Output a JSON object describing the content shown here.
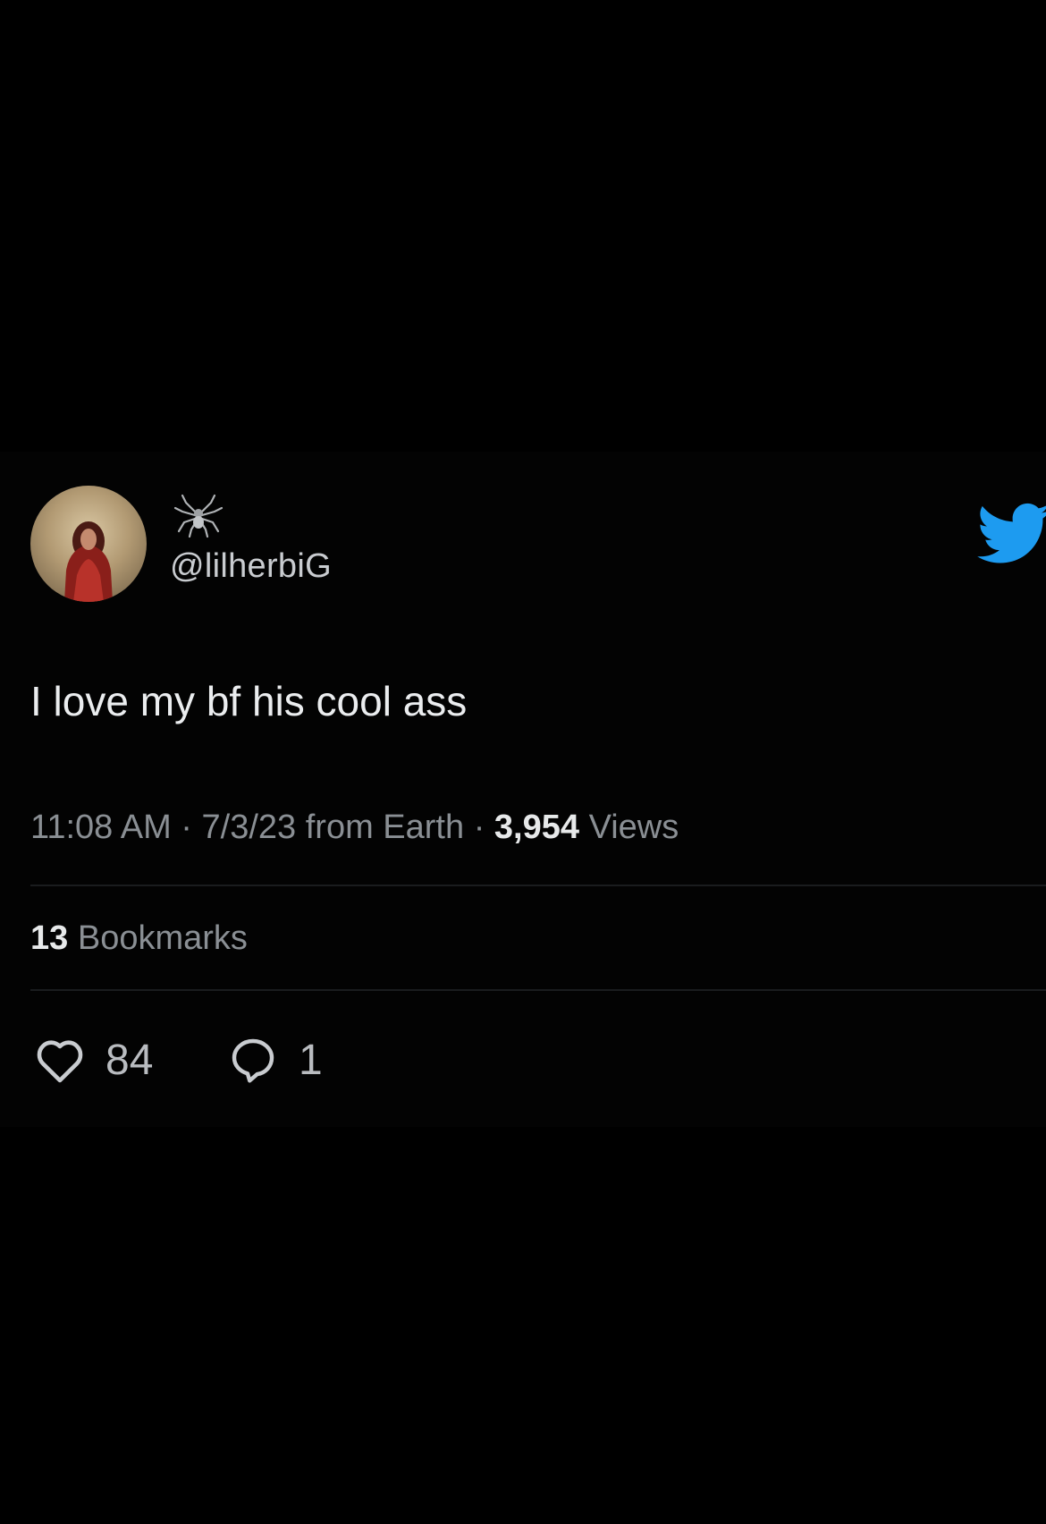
{
  "user": {
    "name_emoji": "spider-emoji",
    "handle": "@lilherbiG",
    "avatar_icon": "profile-photo"
  },
  "brand": {
    "logo_icon": "twitter-bird-icon",
    "logo_color": "#1d9bf0"
  },
  "tweet": {
    "text": "I love my bf his cool ass",
    "time": "11:08 AM",
    "date": "7/3/23",
    "source": "from Earth",
    "views_count": "3,954",
    "views_label": "Views",
    "separator": "·"
  },
  "stats": {
    "bookmarks_count": "13",
    "bookmarks_label": "Bookmarks"
  },
  "actions": {
    "likes_count": "84",
    "replies_count": "1",
    "like_icon": "heart-icon",
    "reply_icon": "comment-bubble-icon"
  }
}
